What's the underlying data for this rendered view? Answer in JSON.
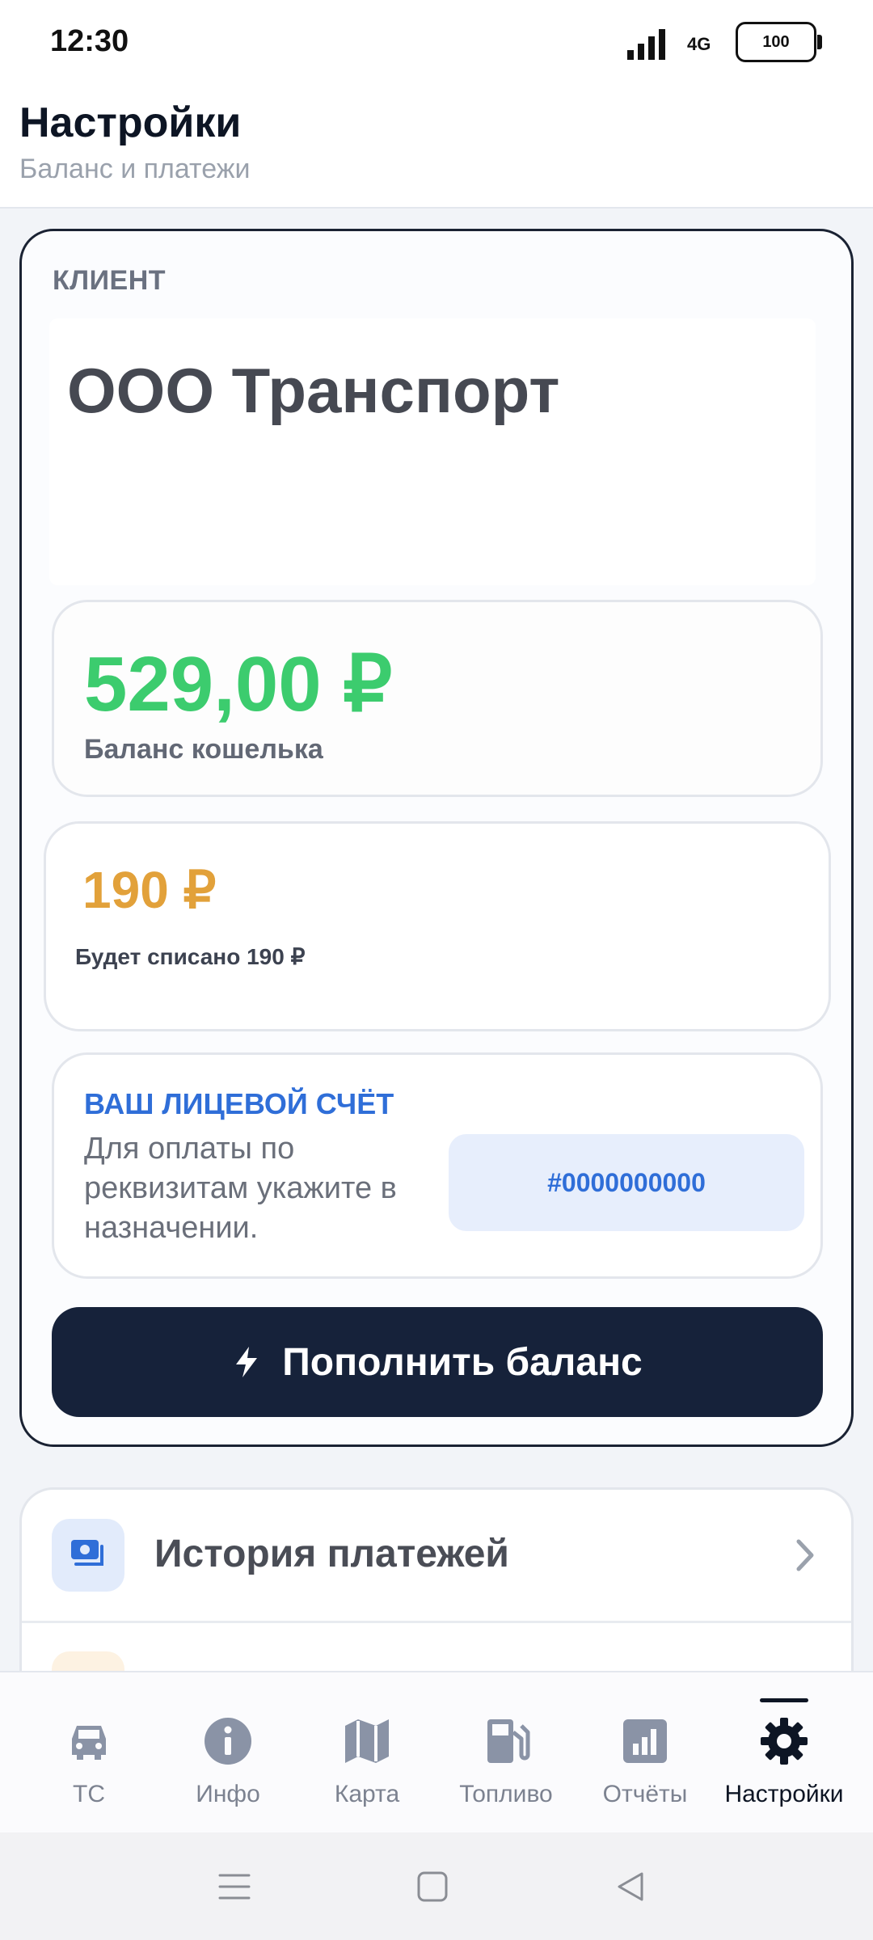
{
  "status": {
    "time": "12:30",
    "network": "4G",
    "battery": "100"
  },
  "header": {
    "title": "Настройки",
    "subtitle": "Баланс и платежи"
  },
  "client": {
    "label": "КЛИЕНТ",
    "name": "ООО Транспорт"
  },
  "balance": {
    "value": "529,00 ₽",
    "label": "Баланс кошелька",
    "color": "#3ccc6e"
  },
  "charge": {
    "value": "190 ₽",
    "label": "Будет списано 190 ₽",
    "color": "#e2a13a"
  },
  "account": {
    "title": "ВАШ ЛИЦЕВОЙ СЧЁТ",
    "description": "Для оплаты по реквизитам укажите в назначении.",
    "number": "#0000000000"
  },
  "topup": {
    "label": "Пополнить баланс",
    "icon": "lightning-icon"
  },
  "menu": {
    "items": [
      {
        "label": "История платежей",
        "icon": "payments-icon"
      }
    ]
  },
  "tabbar": {
    "tabs": [
      {
        "label": "ТС",
        "icon": "car-icon"
      },
      {
        "label": "Инфо",
        "icon": "info-icon"
      },
      {
        "label": "Карта",
        "icon": "map-icon"
      },
      {
        "label": "Топливо",
        "icon": "fuel-icon"
      },
      {
        "label": "Отчёты",
        "icon": "reports-icon"
      },
      {
        "label": "Настройки",
        "icon": "gear-icon",
        "active": true
      }
    ]
  },
  "colors": {
    "primary": "#16223a",
    "accent_blue": "#2f6ed8"
  }
}
